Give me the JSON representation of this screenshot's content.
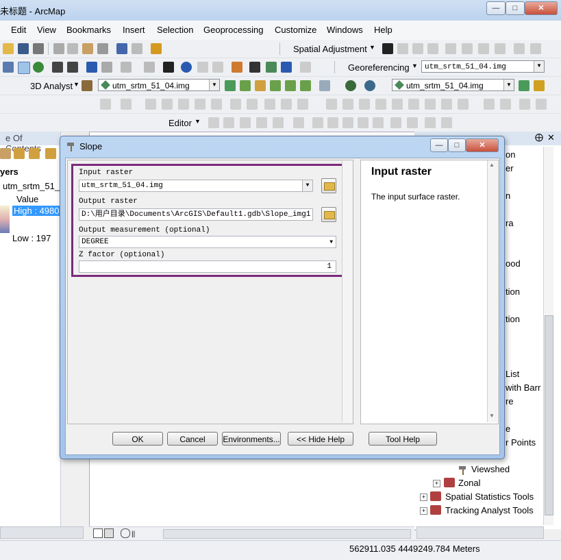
{
  "window": {
    "title": "未标题 - ArcMap"
  },
  "menubar": [
    "Edit",
    "View",
    "Bookmarks",
    "Insert",
    "Selection",
    "Geoprocessing",
    "Customize",
    "Windows",
    "Help"
  ],
  "toolbars": {
    "spatial_adjustment": "Spatial Adjustment",
    "georeferencing": "Georeferencing",
    "georef_layer": "utm_srtm_51_04.img",
    "analyst_3d": "3D Analyst",
    "analyst_layer": "utm_srtm_51_04.img",
    "analyst_layer2": "utm_srtm_51_04.img",
    "editor": "Editor"
  },
  "toc": {
    "title": "e Of Contents",
    "layers_label": "yers",
    "layer_name": "utm_srtm_51_0",
    "value_label": "Value",
    "high_label": "High : 4980",
    "low_label": "Low : 197"
  },
  "toolbox": {
    "fragments": [
      "on",
      "er",
      "n",
      "ra",
      "ood",
      "tion",
      "tion",
      "List",
      "with Barr",
      "re",
      "e",
      "r Points"
    ],
    "items": [
      {
        "label": "Viewshed"
      },
      {
        "label": "Zonal"
      },
      {
        "label": "Spatial Statistics Tools"
      },
      {
        "label": "Tracking Analyst Tools"
      }
    ]
  },
  "dialog": {
    "title": "Slope",
    "input_raster_label": "Input raster",
    "input_raster_value": "utm_srtm_51_04.img",
    "output_raster_label": "Output raster",
    "output_raster_value": "D:\\用户目录\\Documents\\ArcGIS\\Default1.gdb\\Slope_img1",
    "measurement_label": "Output measurement (optional)",
    "measurement_value": "DEGREE",
    "zfactor_label": "Z factor (optional)",
    "zfactor_value": "1",
    "help_title": "Input raster",
    "help_text": "The input surface raster.",
    "buttons": {
      "ok": "OK",
      "cancel": "Cancel",
      "environments": "Environments...",
      "hide_help": "<< Hide Help",
      "tool_help": "Tool Help"
    }
  },
  "status": {
    "coordinates": "562911.035  4449249.784 Meters"
  },
  "colors": {
    "highlight": "#3399ff",
    "dialog_frame": "#a5c4ea",
    "annotation_box": "#7b2a7b"
  }
}
